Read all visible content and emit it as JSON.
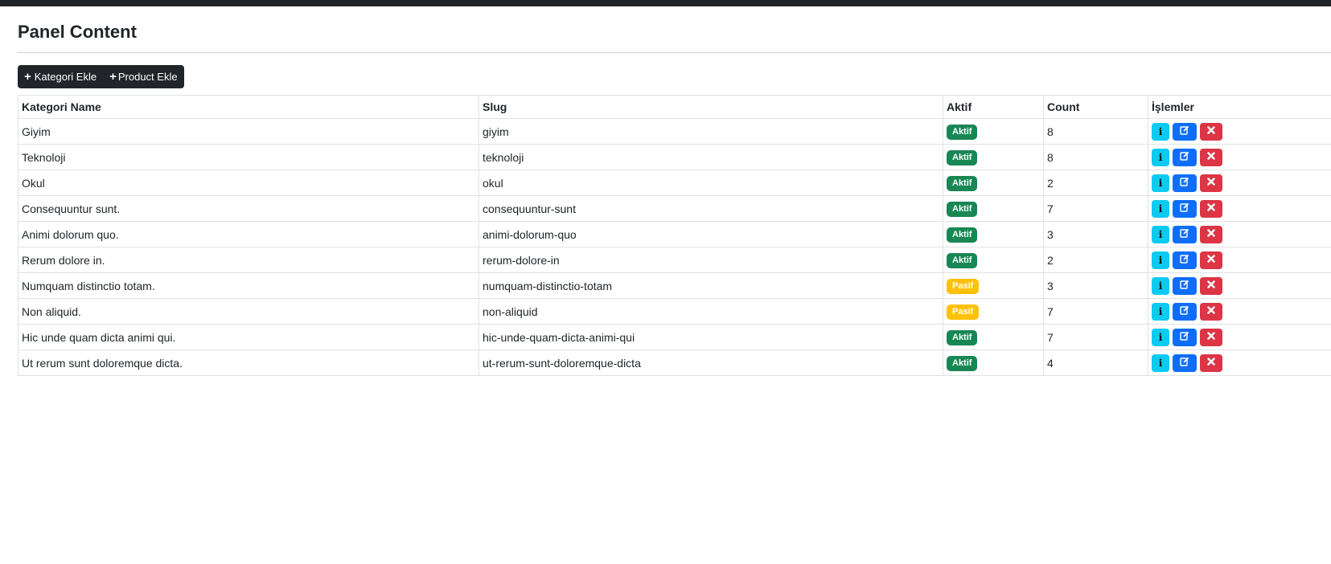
{
  "page": {
    "title": "Panel Content"
  },
  "toolbar": {
    "add_category_label": "Kategori Ekle",
    "add_product_label": "Product Ekle"
  },
  "colors": {
    "active_badge": "#198754",
    "passive_badge": "#ffc107",
    "info_button": "#0dcaf0",
    "edit_button": "#0d6efd",
    "delete_button": "#dc3545",
    "dark_button": "#212529"
  },
  "icons": {
    "add": "plus-icon",
    "info": "info-icon",
    "edit": "edit-icon",
    "delete": "close-icon"
  },
  "table": {
    "headers": [
      "Kategori Name",
      "Slug",
      "Aktif",
      "Count",
      "İşlemler"
    ],
    "rows": [
      {
        "name": "Giyim",
        "slug": "giyim",
        "status": "Aktif",
        "active": true,
        "count": "8"
      },
      {
        "name": "Teknoloji",
        "slug": "teknoloji",
        "status": "Aktif",
        "active": true,
        "count": "8"
      },
      {
        "name": "Okul",
        "slug": "okul",
        "status": "Aktif",
        "active": true,
        "count": "2"
      },
      {
        "name": "Consequuntur sunt.",
        "slug": "consequuntur-sunt",
        "status": "Aktif",
        "active": true,
        "count": "7"
      },
      {
        "name": "Animi dolorum quo.",
        "slug": "animi-dolorum-quo",
        "status": "Aktif",
        "active": true,
        "count": "3"
      },
      {
        "name": "Rerum dolore in.",
        "slug": "rerum-dolore-in",
        "status": "Aktif",
        "active": true,
        "count": "2"
      },
      {
        "name": "Numquam distinctio totam.",
        "slug": "numquam-distinctio-totam",
        "status": "Pasif",
        "active": false,
        "count": "3"
      },
      {
        "name": "Non aliquid.",
        "slug": "non-aliquid",
        "status": "Pasif",
        "active": false,
        "count": "7"
      },
      {
        "name": "Hic unde quam dicta animi qui.",
        "slug": "hic-unde-quam-dicta-animi-qui",
        "status": "Aktif",
        "active": true,
        "count": "7"
      },
      {
        "name": "Ut rerum sunt doloremque dicta.",
        "slug": "ut-rerum-sunt-doloremque-dicta",
        "status": "Aktif",
        "active": true,
        "count": "4"
      }
    ]
  }
}
